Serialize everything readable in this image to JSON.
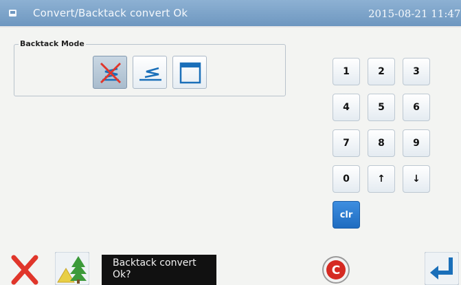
{
  "titlebar": {
    "title": "Convert/Backtack convert Ok",
    "clock": "2015-08-21 11:47"
  },
  "backtack_mode": {
    "label": "Backtack Mode",
    "options": [
      {
        "icon": "backtack-off-icon",
        "selected": true
      },
      {
        "icon": "backtack-zigzag-icon",
        "selected": false
      },
      {
        "icon": "backtack-frame-icon",
        "selected": false
      }
    ]
  },
  "keypad": {
    "keys": [
      "1",
      "2",
      "3",
      "4",
      "5",
      "6",
      "7",
      "8",
      "9",
      "0",
      "↑",
      "↓",
      "clr"
    ]
  },
  "bottom": {
    "message_line1": "Backtack convert",
    "message_line2": "Ok?",
    "cancel_icon": "close-icon",
    "tree_icon": "tree-icon",
    "c_icon": "c-circle-icon",
    "enter_icon": "enter-icon"
  },
  "colors": {
    "titlebar": "#7aa2c9",
    "clr_key": "#2a7bd1",
    "cancel": "#e0362b"
  }
}
